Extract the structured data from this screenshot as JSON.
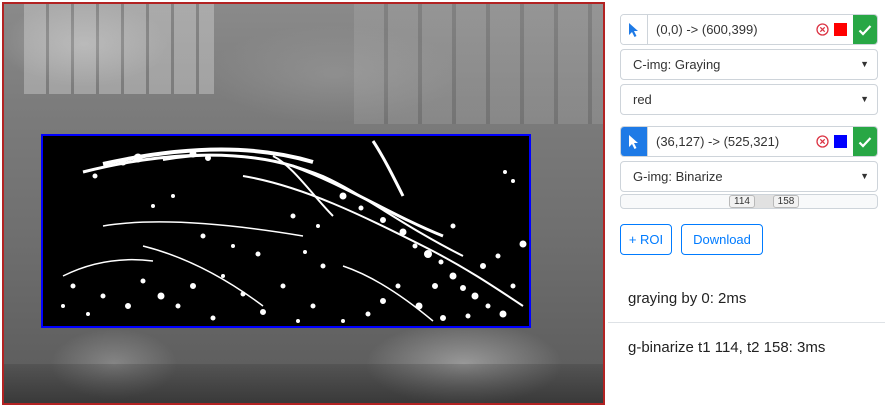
{
  "colors": {
    "roi1": "#ff0000",
    "roi2": "#0000ff",
    "ok": "#28a745",
    "primary": "#007bff",
    "canvas_border": "#b22222"
  },
  "roi1": {
    "coords": "(0,0) -> (600,399)",
    "swatch_color": "red",
    "operation": "C-img: Graying",
    "color_select": "red"
  },
  "roi2": {
    "coords": "(36,127) -> (525,321)",
    "swatch_color": "blue",
    "operation": "G-img: Binarize",
    "threshold_low": "114",
    "threshold_high": "158",
    "threshold_low_frac": 0.447,
    "threshold_high_frac": 0.62
  },
  "actions": {
    "add_roi": "+ ROI",
    "download": "Download"
  },
  "log": [
    "graying by 0: 2ms",
    "g-binarize t1 114, t2 158: 3ms"
  ],
  "icons": {
    "cursor": "cursor-arrow-icon",
    "remove": "circle-x-icon",
    "ok": "check-icon",
    "dropdown": "caret-down-icon"
  }
}
